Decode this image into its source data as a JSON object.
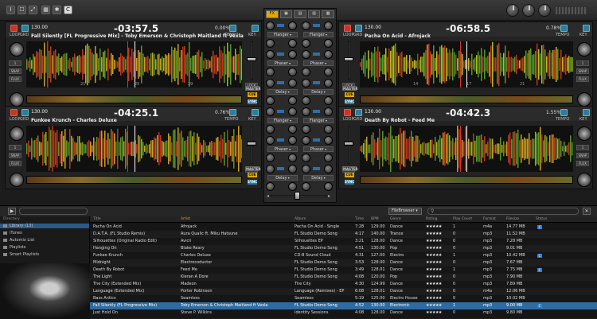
{
  "topbar": {
    "buttons": [
      "I",
      "☐",
      "⤢",
      "▦",
      "✱",
      "C"
    ]
  },
  "decks": [
    {
      "id": "A",
      "bpm": "130.00",
      "time": "-03:57.5",
      "pitch": "0.00%",
      "title": "Fall Silently [FL Progressive Mix] - Toby Emerson & Christoph Maitland ft Vexla",
      "beats": [
        "21",
        "25",
        "29"
      ]
    },
    {
      "id": "B",
      "bpm": "130.00",
      "time": "-06:58.5",
      "pitch": "0.78%",
      "title": "Pacha On Acid - Afrojack",
      "beats": [
        "14",
        "17",
        "21"
      ]
    },
    {
      "id": "C",
      "bpm": "130.00",
      "time": "-04:25.1",
      "pitch": "0.76%",
      "title": "Funkee Krunch - Charles Deluxe",
      "beats": []
    },
    {
      "id": "D",
      "bpm": "130.00",
      "time": "-04:42.3",
      "pitch": "1.55%",
      "title": "Death By Robot - Feed Me",
      "beats": []
    }
  ],
  "deck_labels": {
    "loop": "LOOP",
    "grid": "GRD",
    "sync": "SYNC",
    "master": "MASTER",
    "cue": "CUE",
    "tempo": "TEMPO",
    "key": "KEY",
    "flux": "FLUX",
    "snap": "SNAP",
    "lock": "LOCK",
    "size": "1"
  },
  "mixer": {
    "fx": [
      "Flanger",
      "Flanger",
      "Phaser",
      "Phaser",
      "Delay",
      "Delay",
      "Flanger",
      "Flanger",
      "Phaser",
      "Phaser",
      "Delay",
      "Delay"
    ],
    "tabs": [
      "FX",
      "▣",
      "▤",
      "▥",
      "▦"
    ]
  },
  "browser": {
    "search_placeholder": "",
    "mode_select": "FileBrowser",
    "sidebar_header": "Directory",
    "sidebar": [
      "Library (13)",
      "iTunes",
      "Automix List",
      "Playlists",
      "Smart Playlists"
    ],
    "columns": [
      "Title",
      "Artist",
      "Album",
      "Time",
      "BPM",
      "Genre",
      "Rating",
      "Play Count",
      "Format",
      "Filesize",
      "Status"
    ],
    "rows": [
      [
        "Pacha On Acid",
        "Afrojack",
        "Pacha On Acid - Single",
        "7:28",
        "129.00",
        "Dance",
        "★★★★★",
        "1",
        "m4a",
        "14.77 MB"
      ],
      [
        "D.A.T.A. (FL Studio Remix)",
        "Aura Qualic ft. Miku Hatsune",
        "FL Studio Demo Song",
        "4:17",
        "140.00",
        "Trance",
        "★★★★★",
        "0",
        "mp3",
        "11.52 MB"
      ],
      [
        "Silhouettes (Original Radio Edit)",
        "Avicii",
        "Silhouettes EP",
        "3:21",
        "128.00",
        "Dance",
        "★★★★★",
        "0",
        "mp3",
        "7.28 MB"
      ],
      [
        "Hanging On",
        "Blake Reary",
        "FL Studio Demo Song",
        "4:51",
        "130.00",
        "Pop",
        "★★★★★",
        "0",
        "mp3",
        "9.01 MB"
      ],
      [
        "Funkee Krunch",
        "Charles Deluxe",
        "CD-B Sound Cloud",
        "4:31",
        "127.00",
        "Electro",
        "★★★★★",
        "1",
        "mp3",
        "10.42 MB"
      ],
      [
        "Midnight",
        "Electrocoductor",
        "FL Studio Demo Song",
        "3:53",
        "128.00",
        "Dance",
        "★★★★★",
        "0",
        "mp3",
        "7.67 MB"
      ],
      [
        "Death By Robot",
        "Feed Me",
        "FL Studio Demo Song",
        "3:49",
        "128.01",
        "Dance",
        "★★★★★",
        "1",
        "mp3",
        "7.75 MB"
      ],
      [
        "The Light",
        "Kieran A Dore",
        "FL Studio Demo Song",
        "4:08",
        "120.00",
        "Pop",
        "★★★★★",
        "0",
        "mp3",
        "7.90 MB"
      ],
      [
        "The City (Extended Mix)",
        "Madeon",
        "The City",
        "4:30",
        "124.99",
        "Dance",
        "★★★★★",
        "0",
        "mp3",
        "7.89 MB"
      ],
      [
        "Language (Extended Mix)",
        "Porter Robinson",
        "Language (Remixes) - EP",
        "6:08",
        "128.01",
        "Dance",
        "★★★★★",
        "0",
        "m4a",
        "12.06 MB"
      ],
      [
        "Bass Antics",
        "Seamless",
        "Seamless",
        "5:19",
        "125.00",
        "Electro House",
        "★★★★★",
        "0",
        "mp3",
        "10.02 MB"
      ],
      [
        "Fall Silently (FL Progressive Mix)",
        "Toby Emerson & Christoph Maitland ft Vexla",
        "FL Studio Demo Song",
        "4:52",
        "130.00",
        "Electronic",
        "★★★★★",
        "1",
        "mp3",
        "9.00 MB"
      ],
      [
        "Just Hold On",
        "Steve P. Wilkins",
        "Identity Sessions",
        "4:08",
        "128.00",
        "Dance",
        "★★★★★",
        "0",
        "mp3",
        "9.80 MB"
      ]
    ]
  }
}
